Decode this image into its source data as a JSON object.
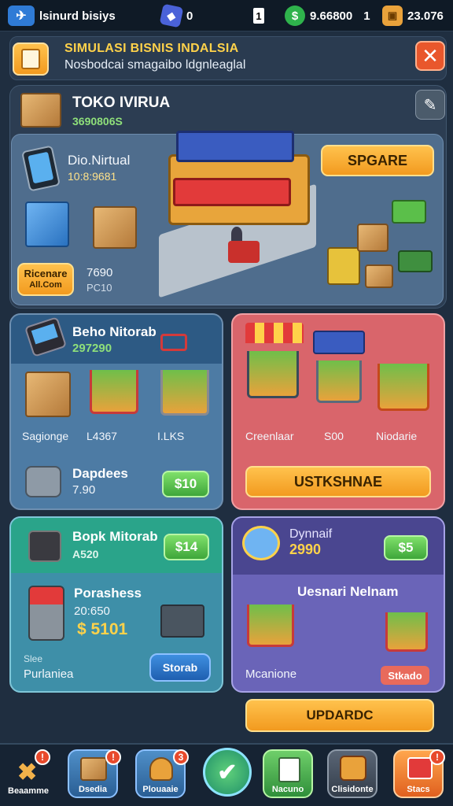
{
  "topbar": {
    "app_name": "lsinurd bisiys",
    "gems": "0",
    "level": "1",
    "cash": "9.66800",
    "cash_level": "1",
    "coins": "23.076"
  },
  "header": {
    "title": "SIMULASI BISNIS INDALSIA",
    "subtitle": "Nosbodcai smagaibo ldgnleaglal"
  },
  "shop": {
    "name": "TOKO IVIRUA",
    "value": "3690806S",
    "device_label": "Dio.Nirtual",
    "device_value": "10:8:9681",
    "rename_button": "Ricenare",
    "rename_sub": "All.Com",
    "stat_value": "7690",
    "stat_sub": "PC10",
    "upgrade_button": "SPGARE"
  },
  "card_left_top": {
    "title": "Beho Nitorab",
    "value": "297290",
    "label_a": "Sagionge",
    "label_b": "L4367",
    "label_c": "I.LKS",
    "item_title": "Dapdees",
    "item_value": "7.90",
    "price_button": "$10"
  },
  "card_right_top": {
    "label_a": "Creenlaar",
    "label_b": "S00",
    "label_c": "Niodarie",
    "action_button": "USTKSHNAE"
  },
  "card_left_bottom": {
    "title": "Bopk Mitorab",
    "value": "A520",
    "price_button": "$14",
    "item_title": "Porashess",
    "item_value": "20:650",
    "item_price": "$ 5101",
    "side_label_a": "Slee",
    "side_label_b": "Purlaniea",
    "action_button": "Storab"
  },
  "card_right_bottom": {
    "title": "Dynnaif",
    "value": "2990",
    "price_button": "$5",
    "subtitle": "Uesnari Nelnam",
    "side_label": "Mcanione",
    "tag": "Stkado"
  },
  "upgrade_button": "UPDARDC",
  "nav": {
    "items": [
      {
        "label": "Beaamme",
        "badge": "!"
      },
      {
        "label": "Dsedia",
        "badge": "!"
      },
      {
        "label": "Plouaaie",
        "badge": "3"
      },
      {
        "label": ""
      },
      {
        "label": "Nacuno"
      },
      {
        "label": "Clisidonte"
      },
      {
        "label": "Stacs",
        "badge": "!"
      }
    ]
  },
  "colors": {
    "accent_orange": "#f29a1f",
    "green": "#3ea63a",
    "card_blue": "#4d7ba4",
    "card_red": "#d9656b",
    "card_teal": "#3e8fa8",
    "card_purple": "#6a64b8"
  }
}
